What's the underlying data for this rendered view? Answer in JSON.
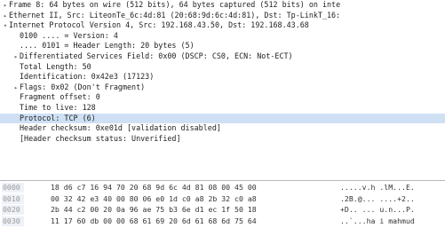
{
  "tree": [
    {
      "indent": 0,
      "toggle": "▸",
      "text": "Frame 8: 64 bytes on wire (512 bits), 64 bytes captured (512 bits) on inte",
      "selected": false
    },
    {
      "indent": 0,
      "toggle": "▸",
      "text": "Ethernet II, Src: LiteonTe_6c:4d:81 (20:68:9d:6c:4d:81), Dst: Tp-LinkT_16:",
      "selected": false
    },
    {
      "indent": 0,
      "toggle": "▾",
      "text": "Internet Protocol Version 4, Src: 192.168.43.50, Dst: 192.168.43.68",
      "selected": false
    },
    {
      "indent": 1,
      "toggle": "",
      "text": "0100 .... = Version: 4",
      "selected": false
    },
    {
      "indent": 1,
      "toggle": "",
      "text": ".... 0101 = Header Length: 20 bytes (5)",
      "selected": false
    },
    {
      "indent": 1,
      "toggle": "▸",
      "text": "Differentiated Services Field: 0x00 (DSCP: CS0, ECN: Not-ECT)",
      "selected": false
    },
    {
      "indent": 1,
      "toggle": "",
      "text": "Total Length: 50",
      "selected": false
    },
    {
      "indent": 1,
      "toggle": "",
      "text": "Identification: 0x42e3 (17123)",
      "selected": false
    },
    {
      "indent": 1,
      "toggle": "▸",
      "text": "Flags: 0x02 (Don't Fragment)",
      "selected": false
    },
    {
      "indent": 1,
      "toggle": "",
      "text": "Fragment offset: 0",
      "selected": false
    },
    {
      "indent": 1,
      "toggle": "",
      "text": "Time to live: 128",
      "selected": false
    },
    {
      "indent": 1,
      "toggle": "",
      "text": "Protocol: TCP (6)",
      "selected": true
    },
    {
      "indent": 1,
      "toggle": "",
      "text": "Header checksum: 0xe01d [validation disabled]",
      "selected": false
    },
    {
      "indent": 1,
      "toggle": "",
      "text": "[Header checksum status: Unverified]",
      "selected": false
    }
  ],
  "hex": [
    {
      "offset": "0000",
      "bytes": "18 d6 c7 16 94 70 20 68  9d 6c 4d 81 08 00 45 00",
      "ascii": ".....v.h .lM...E."
    },
    {
      "offset": "0010",
      "bytes": "00 32 42 e3 40 00 80 06  e0 1d c0 a8 2b 32 c0 a8",
      "ascii": ".2B.@... ....+2.."
    },
    {
      "offset": "0020",
      "bytes": "2b 44 c2 00 20 0a 96 ae  75 b3 6e d1 ec 1f 50 18",
      "ascii": "+D.. ... u.n...P."
    },
    {
      "offset": "0030",
      "bytes": "11 17 60 db 00 00 68 61  69 20 6d 61 68 6d 75 64",
      "ascii": "..`...ha i mahmud"
    }
  ]
}
